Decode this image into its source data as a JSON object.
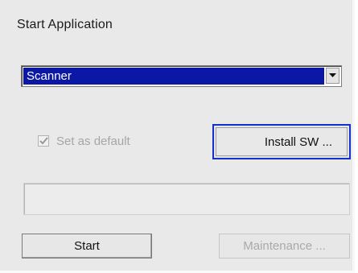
{
  "dialog": {
    "title": "Start Application"
  },
  "application_select": {
    "selected_value": "Scanner"
  },
  "default_checkbox": {
    "label": "Set as default",
    "checked": true,
    "enabled": false
  },
  "buttons": {
    "install_label": "Install SW ...",
    "start_label": "Start",
    "maintenance_label": "Maintenance ..."
  },
  "status_field": {
    "value": ""
  },
  "colors": {
    "selection_highlight": "#0b18a6",
    "focus_border": "#1430c8",
    "dialog_background": "#e9e9e9"
  },
  "icons": [
    "dropdown-arrow-icon",
    "checkmark-icon"
  ]
}
